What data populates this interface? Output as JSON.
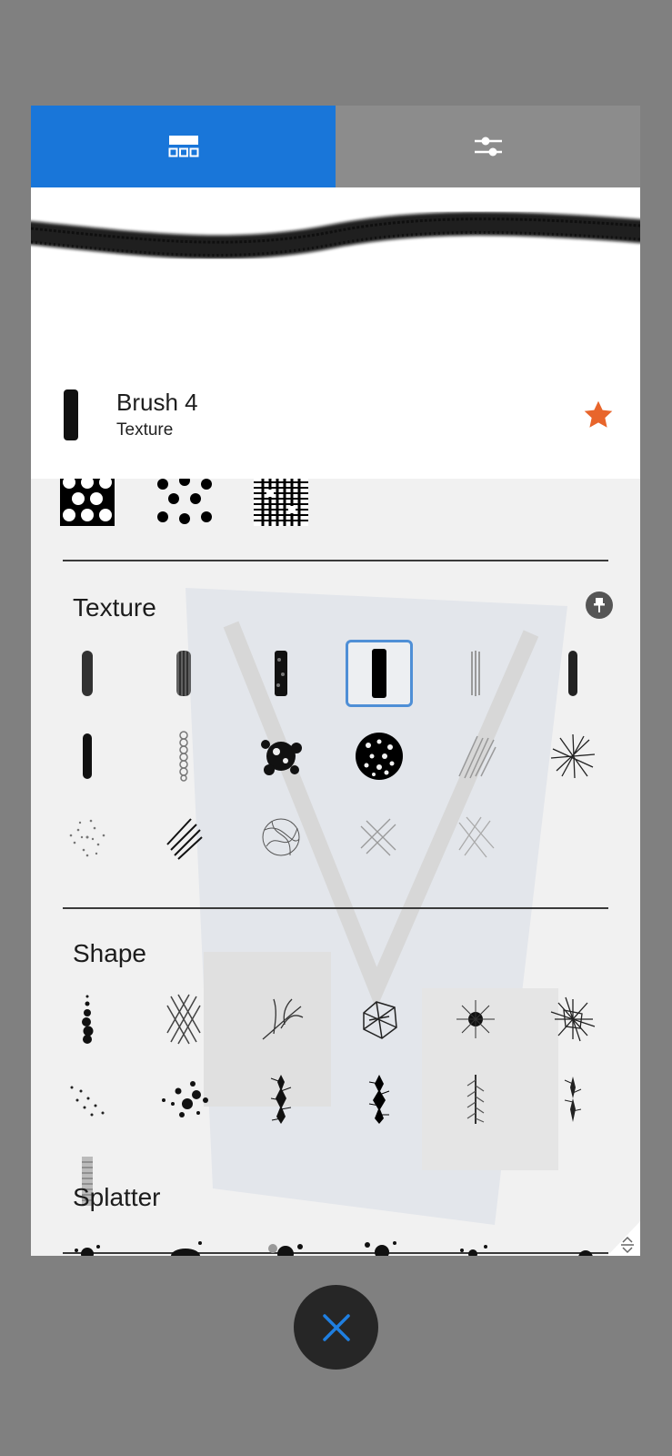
{
  "tabs": [
    {
      "icon": "brush-library-icon",
      "active": true
    },
    {
      "icon": "sliders-icon",
      "active": false
    }
  ],
  "brush": {
    "name": "Brush 4",
    "category": "Texture",
    "favorite": true
  },
  "sections": [
    {
      "title": "Texture",
      "pinned": true,
      "selected_index": 3,
      "brush_count": 17
    },
    {
      "title": "Shape",
      "pinned": false,
      "brush_count": 13
    },
    {
      "title": "Splatter",
      "pinned": false
    }
  ],
  "colors": {
    "accent": "#1976d9",
    "favorite_star": "#e8652b",
    "selection": "#4f8fd6",
    "close_x": "#1f7fe0"
  }
}
